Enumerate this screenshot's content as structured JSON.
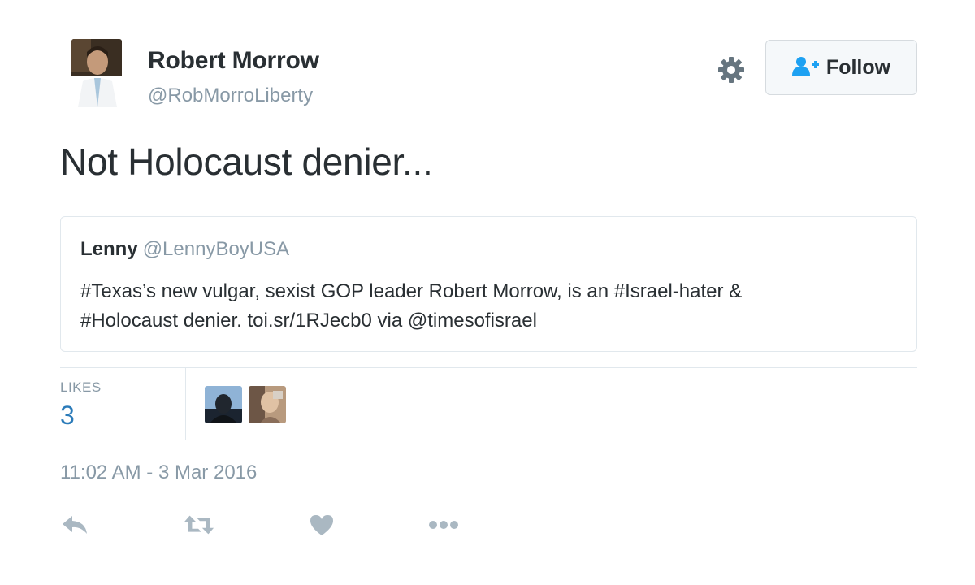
{
  "author": {
    "name": "Robert Morrow",
    "handle": "@RobMorroLiberty"
  },
  "header": {
    "follow_label": "Follow",
    "gear_icon": "gear-icon",
    "follow_icon": "user-plus-icon"
  },
  "tweet": {
    "text": "Not Holocaust denier..."
  },
  "quoted": {
    "name": "Lenny",
    "handle": "@LennyBoyUSA",
    "text_line1": "#Texas’s new vulgar, sexist GOP leader Robert Morrow, is an #Israel-hater &",
    "text_line2": "#Holocaust denier. toi.sr/1RJecb0 via @timesofisrael"
  },
  "stats": {
    "likes_label": "LIKES",
    "likes_count": "3"
  },
  "timestamp": "11:02 AM - 3 Mar 2016",
  "actions": [
    "reply-icon",
    "retweet-icon",
    "heart-icon",
    "more-icon"
  ],
  "colors": {
    "text": "#292f33",
    "muted": "#8899a6",
    "accent": "#2b7bb9",
    "border": "#e1e8ed",
    "follow_icon": "#1da1f2"
  }
}
